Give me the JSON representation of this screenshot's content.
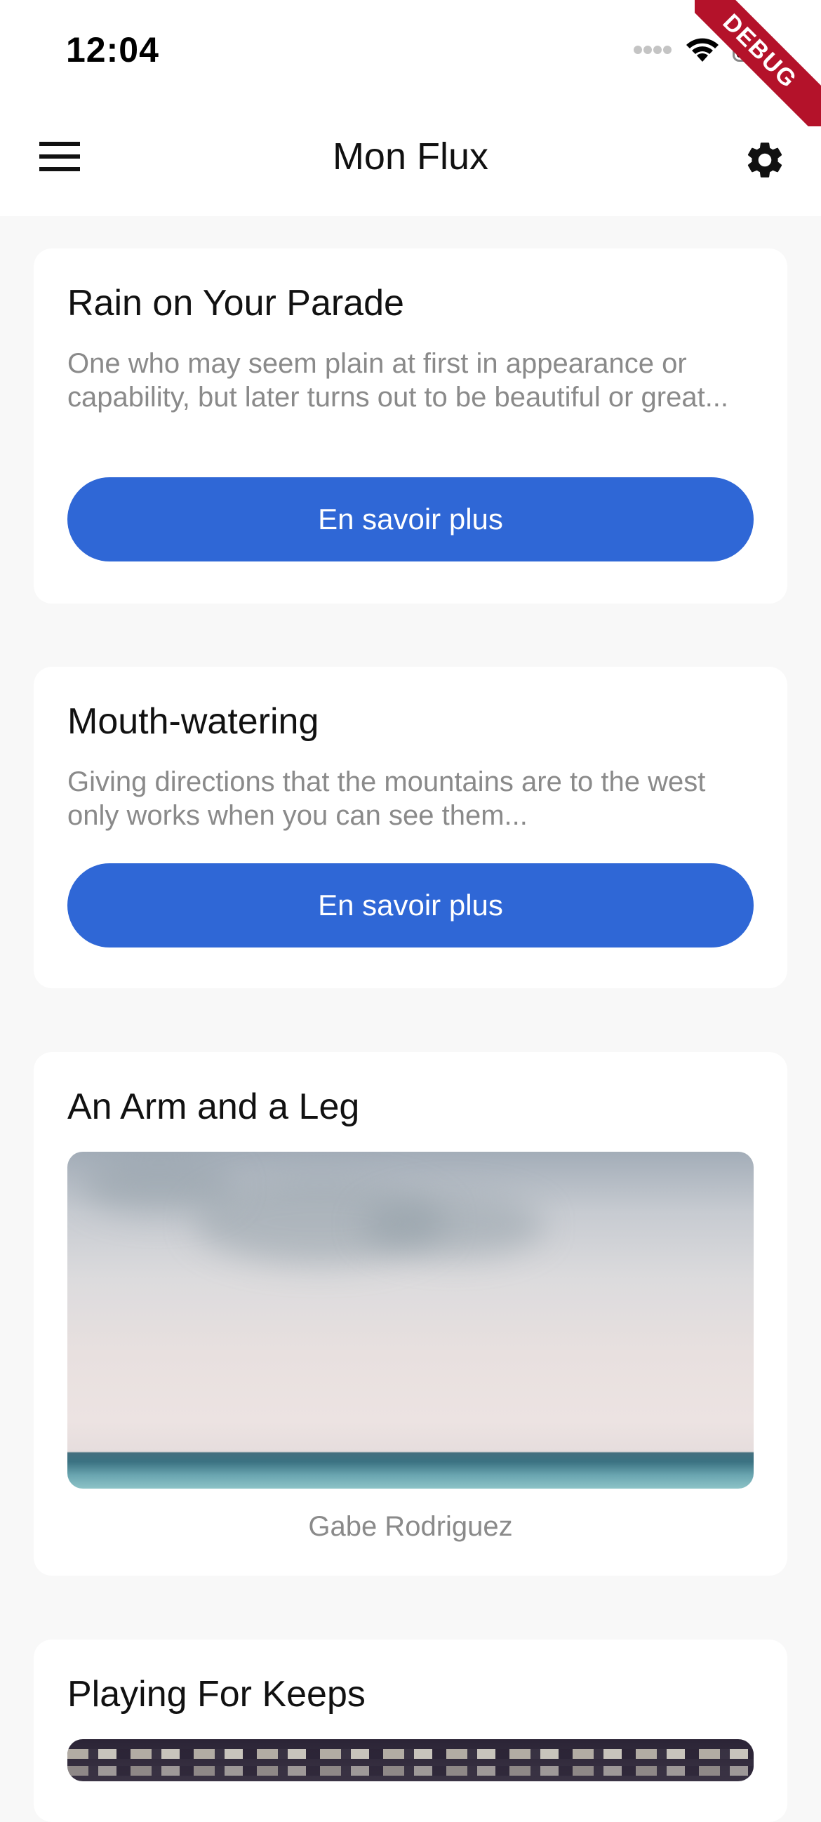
{
  "status_bar": {
    "time": "12:04",
    "icons": [
      "signal-dots-icon",
      "wifi-icon",
      "battery-icon"
    ]
  },
  "debug_banner": "DEBUG",
  "app_bar": {
    "title": "Mon Flux",
    "menu_icon": "menu-icon",
    "settings_icon": "gear-icon"
  },
  "feed": [
    {
      "title": "Rain on Your Parade",
      "description": "One who may seem plain at first in appearance or capability, but later turns out to be beautiful or great...",
      "button_label": "En savoir plus"
    },
    {
      "title": "Mouth-watering",
      "description": "Giving directions that the mountains are to the west only works when you can see them...",
      "button_label": "En savoir plus"
    },
    {
      "title": "An Arm and a Leg",
      "image_caption": "Gabe Rodriguez"
    },
    {
      "title": "Playing For Keeps"
    }
  ],
  "colors": {
    "accent": "#2f67d6",
    "background": "#f8f8f8",
    "card": "#ffffff",
    "secondary_text": "#8a8a8a",
    "debug_banner": "#b4122a"
  }
}
